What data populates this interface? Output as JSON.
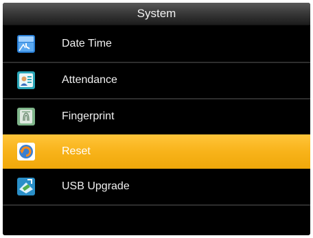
{
  "header": {
    "title": "System"
  },
  "menu": {
    "items": [
      {
        "label": "Date Time",
        "icon": "calendar-clock-icon"
      },
      {
        "label": "Attendance",
        "icon": "attendance-icon"
      },
      {
        "label": "Fingerprint",
        "icon": "fingerprint-icon"
      },
      {
        "label": "Reset",
        "icon": "reset-icon",
        "selected": true
      },
      {
        "label": "USB Upgrade",
        "icon": "usb-upgrade-icon"
      }
    ]
  },
  "colors": {
    "background": "#000000",
    "highlight": "#f8b31a",
    "text": "#f0f0f0",
    "separator": "#2e2e2e"
  }
}
